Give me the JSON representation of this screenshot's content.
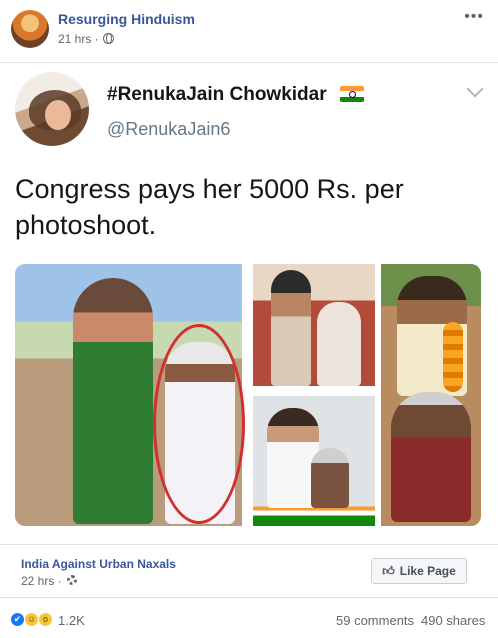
{
  "post": {
    "page_name": "Resurging Hinduism",
    "time": "21 hrs ·",
    "privacy_icon": "globe-icon",
    "more_icon": "more-options-icon"
  },
  "tweet": {
    "display_name": "#RenukaJain Chowkidar",
    "flag_icon": "india-flag-icon",
    "handle": "@RenukaJain6",
    "text": "Congress pays her 5000 Rs. per photoshoot.",
    "expand_icon": "chevron-down-icon"
  },
  "shared_from": {
    "page_name": "India Against Urban Naxals",
    "time": "22 hrs ·",
    "audience_icon": "gear-icon",
    "like_page_label": "Like Page"
  },
  "stats": {
    "reactions": [
      "like",
      "haha",
      "wow"
    ],
    "reaction_count": "1.2K",
    "comments": "59 comments",
    "shares": "490 shares"
  },
  "colors": {
    "link_blue": "#385898",
    "secondary_text": "#606770",
    "highlight_circle": "#d32f2f"
  }
}
